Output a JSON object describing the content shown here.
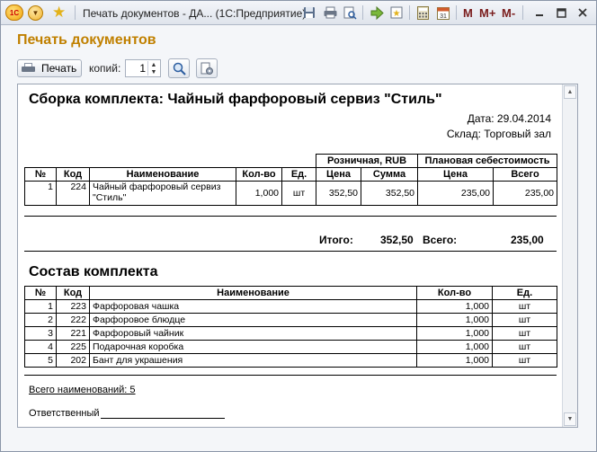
{
  "window": {
    "title": "Печать документов - ДА... (1С:Предприятие)",
    "logo_text": "1С",
    "m_label": "M",
    "m_plus_label": "M+",
    "m_minus_label": "M-"
  },
  "form": {
    "title": "Печать документов"
  },
  "toolbar": {
    "print_label": "Печать",
    "copies_label": "копий:",
    "copies_value": "1"
  },
  "document": {
    "title": "Сборка комплекта: Чайный фарфоровый сервиз \"Стиль\"",
    "date_line": "Дата: 29.04.2014",
    "warehouse_line": "Склад: Торговый зал",
    "table1": {
      "group_headers": [
        "Розничная, RUB",
        "Плановая себестоимость"
      ],
      "headers": [
        "№",
        "Код",
        "Наименование",
        "Кол-во",
        "Ед.",
        "Цена",
        "Сумма",
        "Цена",
        "Всего"
      ],
      "rows": [
        [
          "1",
          "224",
          "Чайный фарфоровый сервиз \"Стиль\"",
          "1,000",
          "шт",
          "352,50",
          "352,50",
          "235,00",
          "235,00"
        ]
      ]
    },
    "totals": {
      "itogo_label": "Итого:",
      "itogo_value": "352,50",
      "vsego_label": "Всего:",
      "vsego_value": "235,00"
    },
    "composition_title": "Состав комплекта",
    "table2": {
      "headers": [
        "№",
        "Код",
        "Наименование",
        "Кол-во",
        "Ед."
      ],
      "rows": [
        [
          "1",
          "223",
          "Фарфоровая чашка",
          "1,000",
          "шт"
        ],
        [
          "2",
          "222",
          "Фарфоровое блюдце",
          "1,000",
          "шт"
        ],
        [
          "3",
          "221",
          "Фарфоровый чайник",
          "1,000",
          "шт"
        ],
        [
          "4",
          "225",
          "Подарочная коробка",
          "1,000",
          "шт"
        ],
        [
          "5",
          "202",
          "Бант для украшения",
          "1,000",
          "шт"
        ]
      ]
    },
    "count_line": "Всего наименований: 5",
    "responsible_label": "Ответственный"
  }
}
